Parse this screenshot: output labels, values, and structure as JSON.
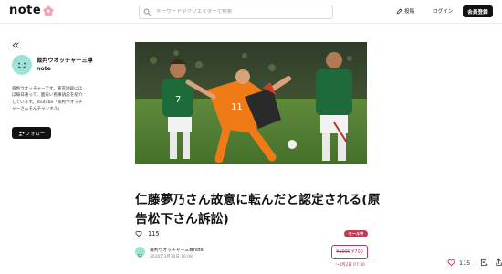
{
  "header": {
    "logo": "note",
    "search_placeholder": "キーワードやクリエイターで検索",
    "post_label": "投稿",
    "login_label": "ログイン",
    "signup_label": "会員登録"
  },
  "sidebar": {
    "author_name": "裁判ウオッチャー三尊note",
    "author_desc": "裁判ウオッチャーです。東京地裁にほぼ毎日通って、面白い民事訴訟を紹介しています。Youtube「裁判ウオッチャーさんそんチャンネル」",
    "follow_label": "フォロー"
  },
  "article": {
    "title": "仁藤夢乃さん故意に転んだと認定される(原告松下さん訴訟)",
    "sale_badge": "セール中",
    "like_count": "115",
    "byline_name": "裁判ウオッチャー三尊note",
    "byline_date": "2026年3月30日 16:08",
    "price_old": "¥1000",
    "price_new": "¥700",
    "sale_until": "〜4月2日 07:30"
  },
  "floating_bar": {
    "like_count": "115"
  },
  "colors": {
    "accent": "#c23b55",
    "avatar": "#9ee3d7",
    "button_dark": "#111111"
  }
}
